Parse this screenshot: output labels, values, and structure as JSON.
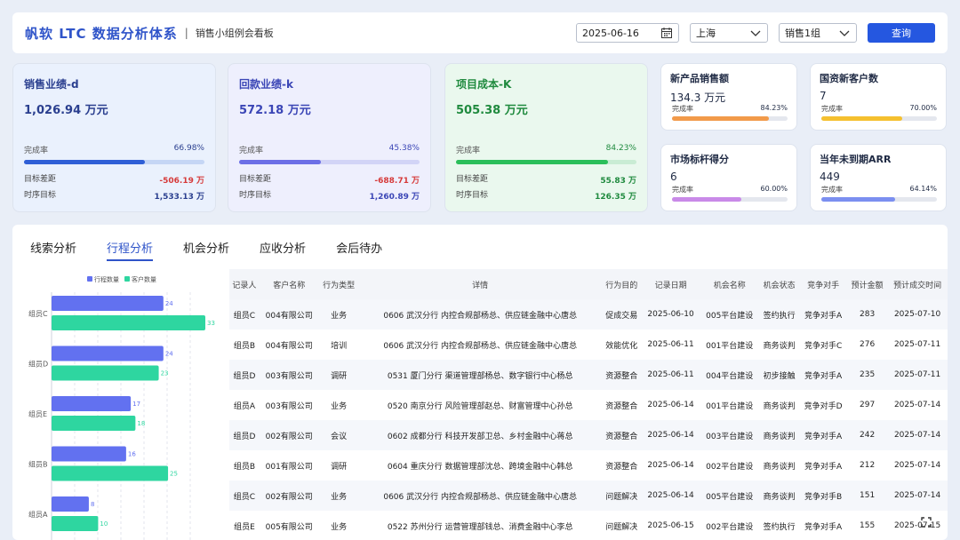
{
  "header": {
    "brand": "帆软 LTC 数据分析体系",
    "separator": "|",
    "subtitle": "销售小组例会看板",
    "date": "2025-06-16",
    "city": "上海",
    "group": "销售1组",
    "query_label": "查询"
  },
  "kpi_big": [
    {
      "title": "销售业绩-d",
      "value": "1,026.94 万元",
      "rate_label": "完成率",
      "rate": "66.98%",
      "progress": 66.98,
      "gap_label": "目标差距",
      "gap": "-506.19 万",
      "target_label": "时序目标",
      "target": "1,533.13 万",
      "bg": "#eaf1fd",
      "title_color": "#2a3f8f",
      "fill": "#2f5fd6",
      "track": "#c5d6f5",
      "gap_color": "#d63a3a",
      "target_color": "#2a3f8f"
    },
    {
      "title": "回款业绩-k",
      "value": "572.18 万元",
      "rate_label": "完成率",
      "rate": "45.38%",
      "progress": 45.38,
      "gap_label": "目标差距",
      "gap": "-688.71 万",
      "target_label": "时序目标",
      "target": "1,260.89 万",
      "bg": "#eeeffd",
      "title_color": "#3b46b6",
      "fill": "#6c6fe6",
      "track": "#d2d4f6",
      "gap_color": "#d63a3a",
      "target_color": "#3b46b6"
    },
    {
      "title": "项目成本-K",
      "value": "505.38 万元",
      "rate_label": "完成率",
      "rate": "84.23%",
      "progress": 84.23,
      "gap_label": "目标差距",
      "gap": "55.83 万",
      "target_label": "时序目标",
      "target": "126.35 万",
      "bg": "#eaf8ee",
      "title_color": "#1f8a3e",
      "fill": "#2bbf5a",
      "track": "#c9ecd4",
      "gap_color": "#1f8a3e",
      "target_color": "#1f8a3e"
    }
  ],
  "kpi_small": [
    {
      "title": "新产品销售额",
      "value": "134.3 万元",
      "rate_label": "完成率",
      "rate": "84.23%",
      "progress": 84.23,
      "fill": "#f29a4a"
    },
    {
      "title": "国资新客户数",
      "value": "7",
      "rate_label": "完成率",
      "rate": "70.00%",
      "progress": 70.0,
      "fill": "#f5c02f"
    },
    {
      "title": "市场标杆得分",
      "value": "6",
      "rate_label": "完成率",
      "rate": "60.00%",
      "progress": 60.0,
      "fill": "#c98ae8"
    },
    {
      "title": "当年未到期ARR",
      "value": "449",
      "rate_label": "完成率",
      "rate": "64.14%",
      "progress": 64.14,
      "fill": "#7b8ff0"
    }
  ],
  "tabs": [
    "线索分析",
    "行程分析",
    "机会分析",
    "应收分析",
    "会后待办"
  ],
  "active_tab": 1,
  "chart_data": {
    "type": "bar",
    "orientation": "horizontal",
    "categories": [
      "组员C",
      "组员D",
      "组员E",
      "组员B",
      "组员A"
    ],
    "series": [
      {
        "name": "行程数量",
        "values": [
          24,
          24,
          17,
          16,
          8
        ],
        "color": "#6271f0"
      },
      {
        "name": "客户数量",
        "values": [
          33,
          23,
          18,
          25,
          10
        ],
        "color": "#2ed6a0"
      }
    ],
    "xlim": [
      0,
      35
    ],
    "legend": "top",
    "grid": true
  },
  "table": {
    "columns": [
      "记录人",
      "客户名称",
      "行为类型",
      "详情",
      "行为目的",
      "记录日期",
      "机会名称",
      "机会状态",
      "竞争对手",
      "预计金额",
      "预计成交时间"
    ],
    "rows": [
      [
        "组员C",
        "004有限公司",
        "业务",
        "0606 武汉分行 内控合规部杨总、供应链金融中心唐总",
        "促成交易",
        "2025-06-10",
        "005平台建设",
        "签约执行",
        "竞争对手A",
        "283",
        "2025-07-10"
      ],
      [
        "组员B",
        "004有限公司",
        "培训",
        "0606 武汉分行 内控合规部杨总、供应链金融中心唐总",
        "效能优化",
        "2025-06-11",
        "001平台建设",
        "商务谈判",
        "竞争对手C",
        "276",
        "2025-07-11"
      ],
      [
        "组员D",
        "003有限公司",
        "调研",
        "0531 厦门分行 渠道管理部杨总、数字银行中心杨总",
        "资源整合",
        "2025-06-11",
        "004平台建设",
        "初步接触",
        "竞争对手A",
        "235",
        "2025-07-11"
      ],
      [
        "组员A",
        "003有限公司",
        "业务",
        "0520 南京分行 风险管理部赵总、财富管理中心孙总",
        "资源整合",
        "2025-06-14",
        "001平台建设",
        "商务谈判",
        "竞争对手D",
        "297",
        "2025-07-14"
      ],
      [
        "组员D",
        "002有限公司",
        "会议",
        "0602 成都分行 科技开发部卫总、乡村金融中心蒋总",
        "资源整合",
        "2025-06-14",
        "003平台建设",
        "商务谈判",
        "竞争对手A",
        "242",
        "2025-07-14"
      ],
      [
        "组员B",
        "001有限公司",
        "调研",
        "0604 重庆分行 数据管理部沈总、跨境金融中心韩总",
        "资源整合",
        "2025-06-14",
        "002平台建设",
        "商务谈判",
        "竞争对手A",
        "212",
        "2025-07-14"
      ],
      [
        "组员C",
        "002有限公司",
        "业务",
        "0606 武汉分行 内控合规部杨总、供应链金融中心唐总",
        "问题解决",
        "2025-06-14",
        "005平台建设",
        "商务谈判",
        "竞争对手B",
        "151",
        "2025-07-14"
      ],
      [
        "组员E",
        "005有限公司",
        "业务",
        "0522 苏州分行 运营管理部钱总、消费金融中心李总",
        "问题解决",
        "2025-06-15",
        "002平台建设",
        "签约执行",
        "竞争对手A",
        "155",
        "2025-07-15"
      ]
    ]
  },
  "icons": {
    "calendar": "calendar-icon",
    "chevron": "chevron-down-icon",
    "fab": "fullscreen-icon"
  }
}
